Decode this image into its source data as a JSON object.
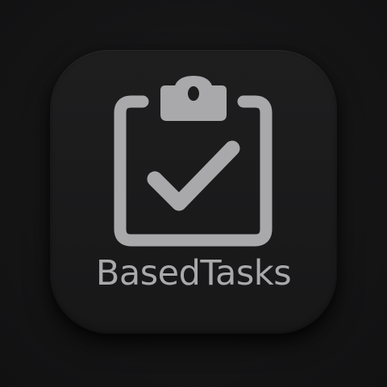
{
  "app": {
    "name": "BasedTasks",
    "icon": "clipboard-check-icon"
  },
  "colors": {
    "background": "#141415",
    "tile": "#1c1c1d",
    "glyph": "#a9a9ab"
  }
}
